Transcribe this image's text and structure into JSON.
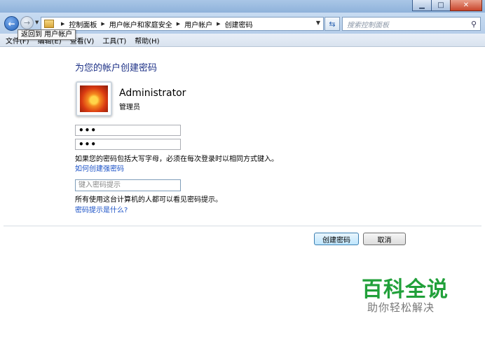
{
  "window": {
    "minimize_icon": "minimize-icon",
    "maximize_icon": "maximize-icon",
    "close_icon": "close-icon"
  },
  "nav": {
    "tooltip": "返回到 用户帐户",
    "breadcrumb": [
      "控制面板",
      "用户帐户和家庭安全",
      "用户帐户",
      "创建密码"
    ],
    "search_placeholder": "搜索控制面板"
  },
  "menu": [
    "文件(F)",
    "编辑(E)",
    "查看(V)",
    "工具(T)",
    "帮助(H)"
  ],
  "content": {
    "title": "为您的帐户创建密码",
    "username": "Administrator",
    "role": "管理员",
    "password_value": "•••",
    "confirm_value": "•••",
    "caps_note": "如果您的密码包括大写字母，必须在每次登录时以相同方式键入。",
    "strong_pwd_link": "如何创建强密码",
    "hint_placeholder": "键入密码提示",
    "hint_note": "所有使用这台计算机的人都可以看见密码提示。",
    "hint_link": "密码提示是什么?"
  },
  "buttons": {
    "create": "创建密码",
    "cancel": "取消"
  },
  "watermark": {
    "title": "百科全说",
    "subtitle": "助你轻松解决"
  },
  "colors": {
    "title_blue": "#1e3287",
    "link_blue": "#1a51c7",
    "watermark_green": "#21a03a"
  }
}
